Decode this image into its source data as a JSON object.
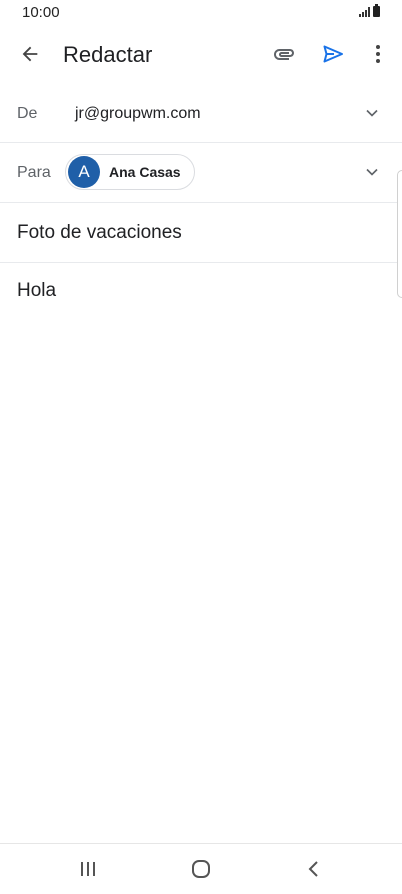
{
  "status_bar": {
    "time": "10:00",
    "signal_icon": "signal-icon",
    "battery_icon": "battery-icon"
  },
  "app_bar": {
    "back_icon": "arrow-left-icon",
    "title": "Redactar",
    "attach_icon": "paperclip-icon",
    "send_icon": "send-icon",
    "more_icon": "more-vert-icon"
  },
  "compose": {
    "from_label": "De",
    "from_value": "jr@groupwm.com",
    "to_label": "Para",
    "recipient": {
      "initial": "A",
      "name": "Ana Casas",
      "avatar_color": "#1f5fa8"
    },
    "subject": "Foto de vacaciones",
    "body": "Hola"
  },
  "colors": {
    "accent": "#1a73e8",
    "text": "#202124",
    "muted": "#5f6368"
  },
  "nav_bar": {
    "recents_icon": "recents-icon",
    "home_icon": "home-icon",
    "back_icon": "back-chevron-icon"
  }
}
